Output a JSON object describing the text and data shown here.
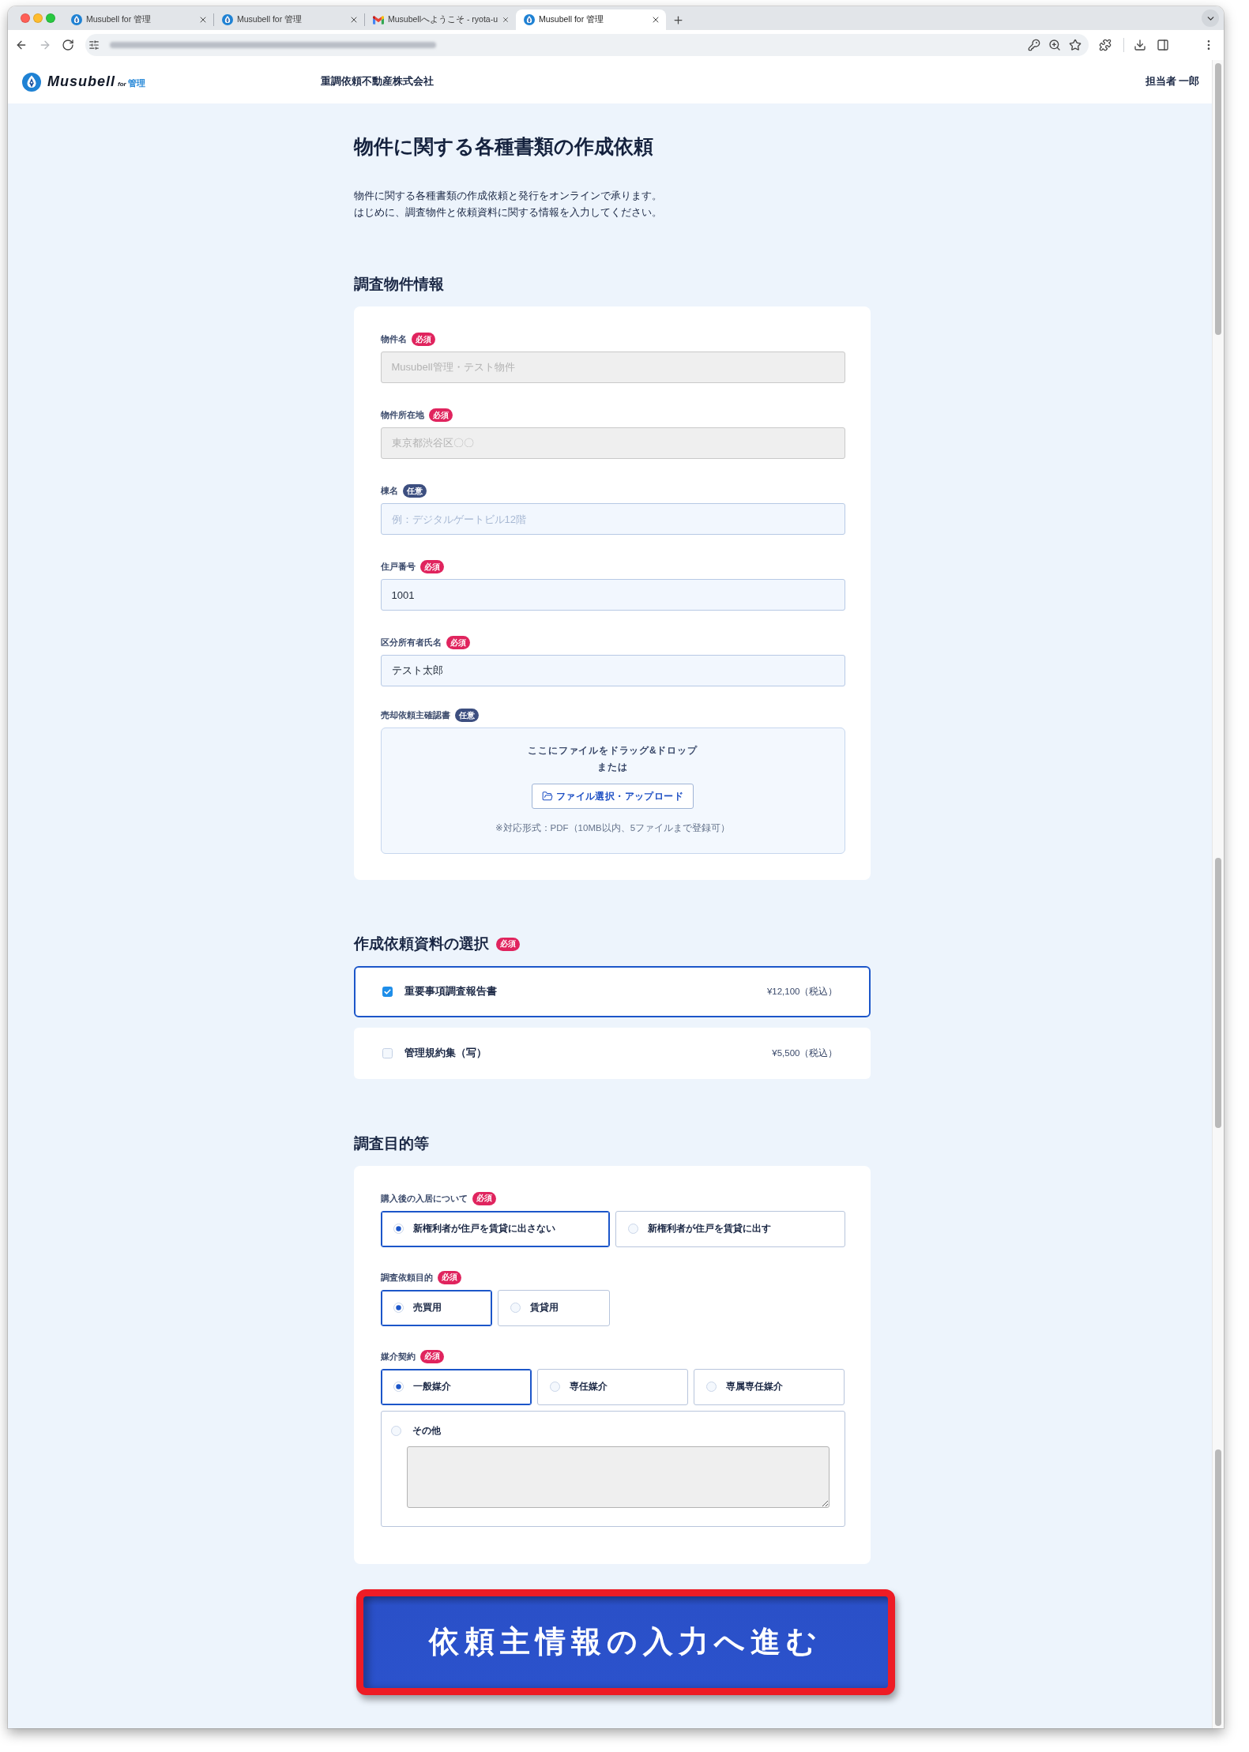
{
  "browser": {
    "tabs": [
      {
        "title": "Musubell for 管理",
        "kind": "app",
        "selected": false
      },
      {
        "title": "Musubell for 管理",
        "kind": "app",
        "selected": false
      },
      {
        "title": "Musubellへようこそ - ryota-u",
        "kind": "mail",
        "selected": false
      },
      {
        "title": "Musubell for 管理",
        "kind": "app",
        "selected": true
      }
    ],
    "nav_buttons": [
      {
        "kind": "back",
        "disabled": false
      },
      {
        "kind": "forward",
        "disabled": true
      },
      {
        "kind": "reload",
        "disabled": false
      }
    ]
  },
  "header": {
    "logo": {
      "wordmark": "Musubell",
      "tag": "for",
      "product": "管理"
    },
    "company": "重調依頼不動産株式会社",
    "user": "担当者 一郎"
  },
  "intro": {
    "title": "物件に関する各種書類の作成依頼",
    "lines": [
      "物件に関する各種書類の作成依頼と発行をオンラインで承ります。",
      "はじめに、調査物件と依頼資料に関する情報を入力してください。"
    ]
  },
  "property": {
    "heading": "調査物件情報",
    "fields": [
      {
        "label": "物件名",
        "badge": {
          "text": "必須",
          "kind": "required"
        },
        "value": "Musubell管理・テスト物件",
        "disabled": true
      },
      {
        "label": "物件所在地",
        "badge": {
          "text": "必須",
          "kind": "required"
        },
        "value": "東京都渋谷区〇〇",
        "disabled": true
      },
      {
        "label": "棟名",
        "badge": {
          "text": "任意",
          "kind": "optional"
        },
        "placeholder": "例：デジタルゲートビル12階",
        "disabled": false
      },
      {
        "label": "住戸番号",
        "badge": {
          "text": "必須",
          "kind": "required"
        },
        "value": "1001",
        "disabled": false
      },
      {
        "label": "区分所有者氏名",
        "badge": {
          "text": "必須",
          "kind": "required"
        },
        "value": "テスト太郎",
        "disabled": false
      }
    ],
    "upload": {
      "label": "売却依頼主確認書",
      "badge": {
        "text": "任意",
        "kind": "optional"
      },
      "drop_text": "ここにファイルをドラッグ&ドロップ",
      "or_text": "または",
      "button": "ファイル選択・アップロード",
      "note": "※対応形式：PDF（10MB以内、5ファイルまで登録可）"
    }
  },
  "documents": {
    "heading": "作成依頼資料の選択",
    "badge": {
      "text": "必須",
      "kind": "required"
    },
    "options": [
      {
        "label": "重要事項調査報告書",
        "price": "¥12,100（税込）",
        "checked": true
      },
      {
        "label": "管理規約集（写）",
        "price": "¥5,500（税込）",
        "checked": false
      }
    ]
  },
  "purpose": {
    "heading": "調査目的等",
    "groups": [
      {
        "label": "購入後の入居について",
        "badge": {
          "text": "必須",
          "kind": "required"
        },
        "options": [
          {
            "label": "新権利者が住戸を賃貸に出さない",
            "kind": "choice",
            "selected": true
          },
          {
            "label": "新権利者が住戸を賃貸に出す",
            "kind": "choice",
            "selected": false
          }
        ]
      },
      {
        "label": "調査依頼目的",
        "badge": {
          "text": "必須",
          "kind": "required"
        },
        "options": [
          {
            "label": "売買用",
            "kind": "choice",
            "selected": true
          },
          {
            "label": "賃貸用",
            "kind": "choice",
            "selected": false
          }
        ]
      },
      {
        "label": "媒介契約",
        "badge": {
          "text": "必須",
          "kind": "required"
        },
        "options": [
          {
            "label": "一般媒介",
            "kind": "choice",
            "selected": true
          },
          {
            "label": "専任媒介",
            "kind": "choice",
            "selected": false
          },
          {
            "label": "専属専任媒介",
            "kind": "choice",
            "selected": false
          },
          {
            "label": "その他",
            "kind": "other",
            "selected": false
          }
        ]
      }
    ]
  },
  "submit": {
    "label": "依頼主情報の入力へ進む",
    "highlighted": true
  }
}
